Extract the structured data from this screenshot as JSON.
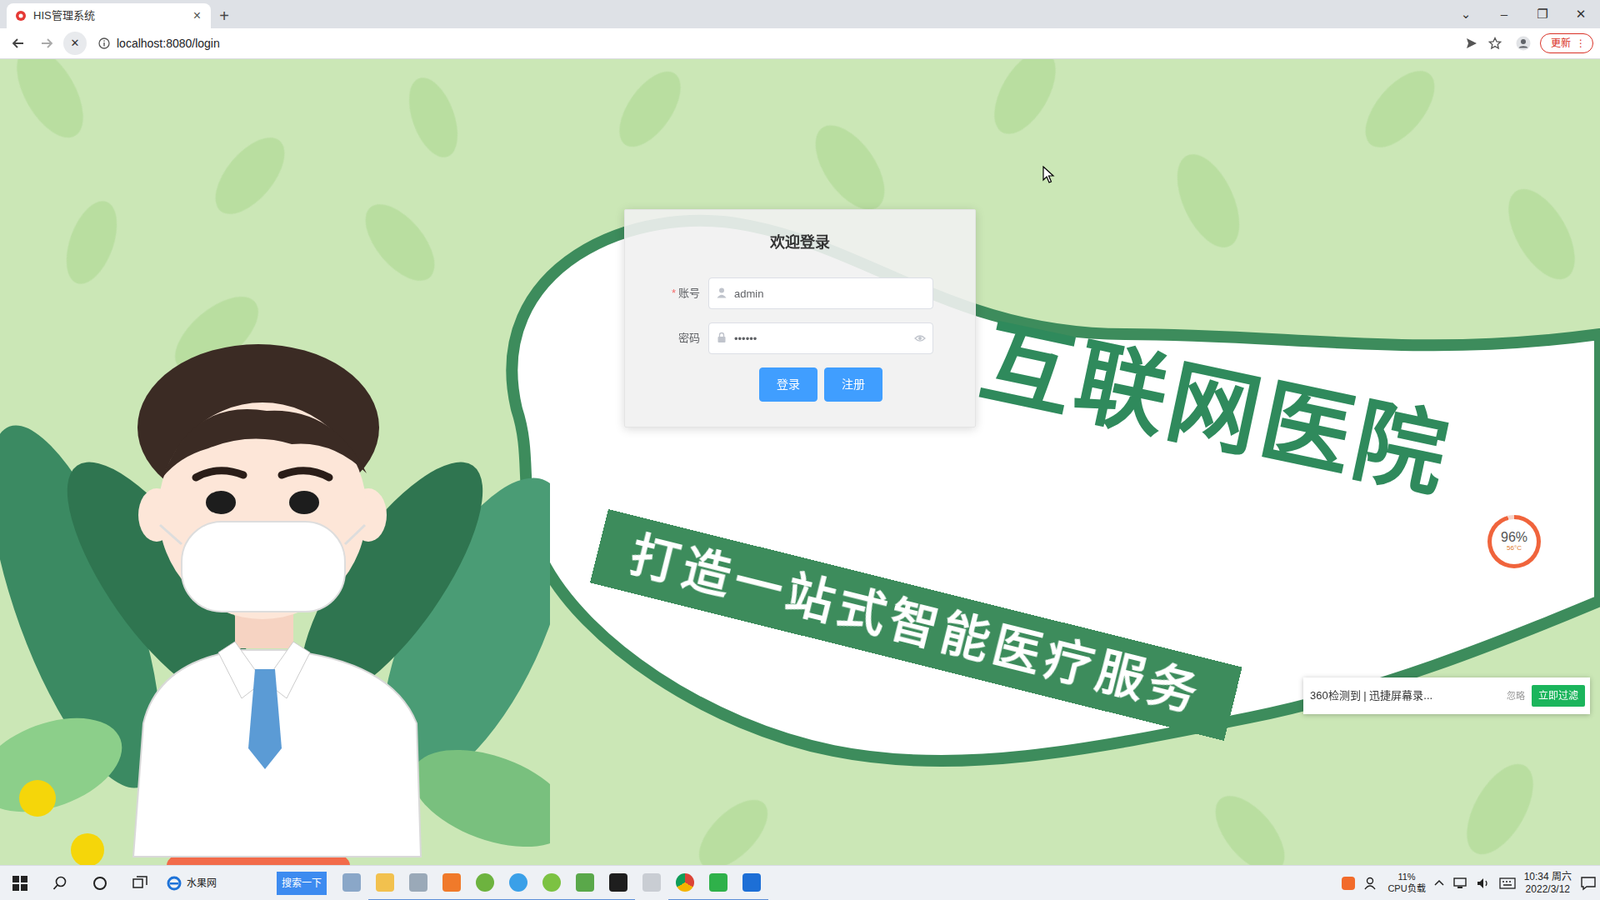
{
  "browser": {
    "tabs": [
      {
        "label": "HIS管理系统",
        "selected": true,
        "close": "×"
      }
    ],
    "new_tab": "+",
    "window_controls": [
      "⌄",
      "–",
      "❐",
      "✕"
    ],
    "stop_button": "✕",
    "address": "localhost:8080/login",
    "update_button": "更新",
    "menu_button": "⋮"
  },
  "login": {
    "title": "欢迎登录",
    "required_mark": "*",
    "fields": [
      {
        "label": "账号",
        "required": true,
        "kind": "text",
        "value": "admin"
      },
      {
        "label": "密码",
        "required": false,
        "kind": "password",
        "value": "••••••"
      }
    ],
    "buttons": [
      "登录",
      "注册"
    ]
  },
  "banner": {
    "headline": "互联网医院",
    "slogan": "打造一站式智能医疗服务"
  },
  "cpu_meter": {
    "reading": "96%",
    "temperature": "56°C",
    "level": 0.96
  },
  "notification": {
    "text": "360检测到 | 迅捷屏幕录...",
    "dismiss": "忽略",
    "action": "立即过滤"
  },
  "taskbar": {
    "pinned_site": "水果网",
    "search_button": "搜索一下",
    "cpu": "11%",
    "cpu_label": "CPU负载",
    "time": "10:34 周六",
    "date": "2022/3/12"
  }
}
